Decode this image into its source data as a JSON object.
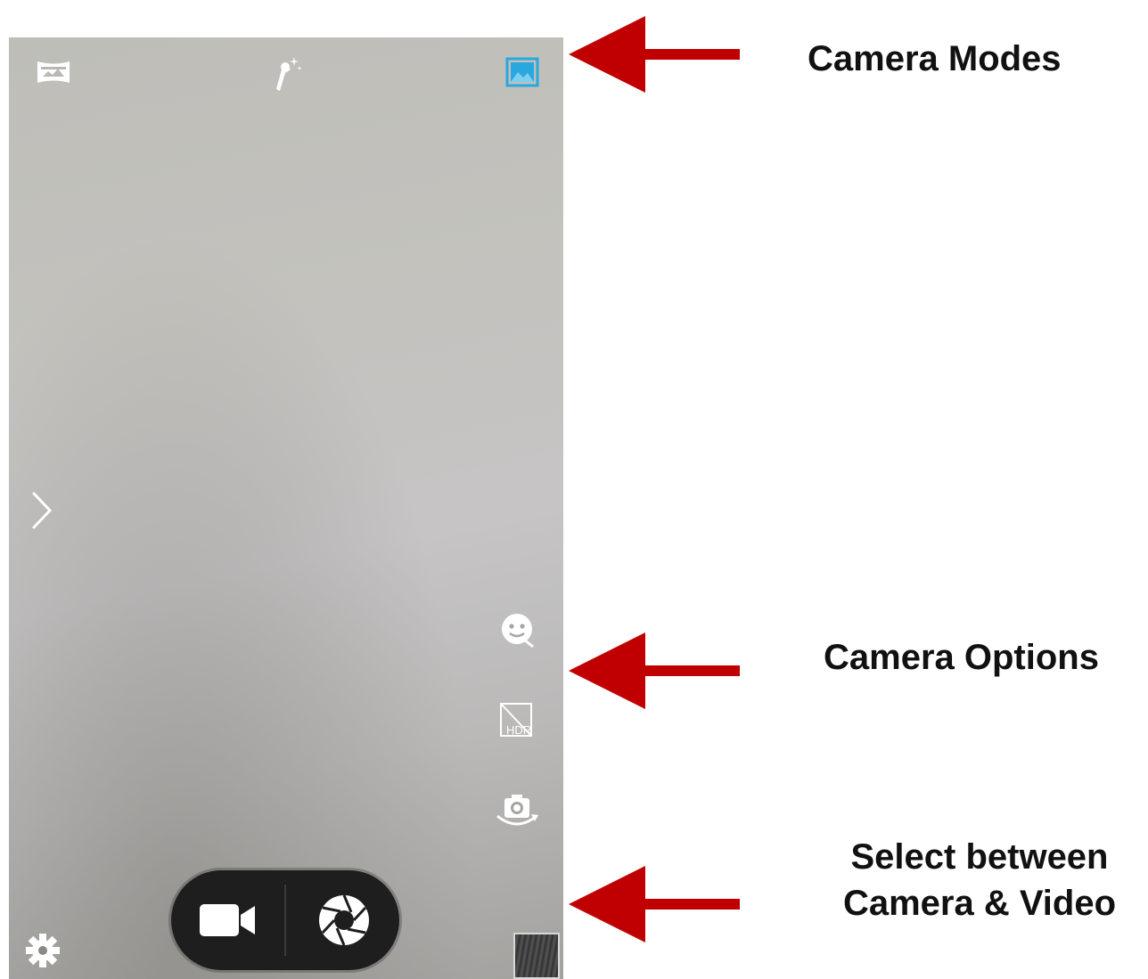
{
  "colors": {
    "arrow": "#c00000",
    "active_mode": "#29a8e0",
    "icon_white": "#ffffff",
    "capture_pill": "#1e1e1e"
  },
  "viewfinder": {
    "modes": [
      {
        "name": "panorama",
        "icon": "panorama-icon",
        "active": false
      },
      {
        "name": "beauty",
        "icon": "magic-wand-icon",
        "active": false
      },
      {
        "name": "photo",
        "icon": "photo-icon",
        "active": true
      }
    ],
    "side_toggle_icon": "chevron-right-icon",
    "options": [
      {
        "icon": "face-detect-icon"
      },
      {
        "icon": "hdr-off-icon",
        "text": "HDR"
      },
      {
        "icon": "switch-camera-icon"
      }
    ],
    "settings_icon": "gear-icon",
    "capture": {
      "video_icon": "video-camera-icon",
      "photo_icon": "shutter-icon"
    },
    "gallery_icon": "gallery-thumbnail"
  },
  "annotations": {
    "modes": "Camera Modes",
    "options": "Camera Options",
    "capture_line1": "Select between",
    "capture_line2": "Camera & Video"
  }
}
